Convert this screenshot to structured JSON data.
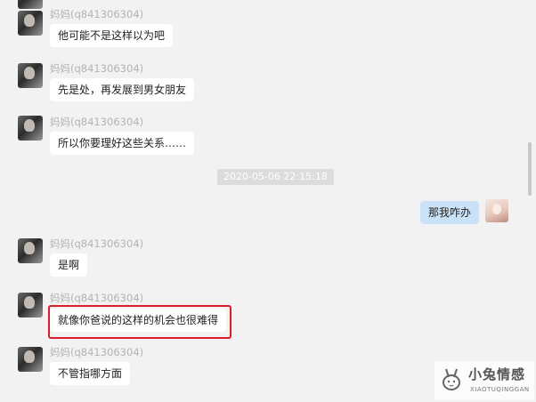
{
  "messages": [
    {
      "sender": "妈妈(q841306304)",
      "text": "他可能不是这样以为吧"
    },
    {
      "sender": "妈妈(q841306304)",
      "text": "先是处，再发展到男女朋友"
    },
    {
      "sender": "妈妈(q841306304)",
      "text": "所以你要理好这些关系……"
    },
    {
      "sender": "妈妈(q841306304)",
      "text": "是啊"
    },
    {
      "sender": "妈妈(q841306304)",
      "text": "就像你爸说的这样的机会也很难得"
    },
    {
      "sender": "妈妈(q841306304)",
      "text": "不管指哪方面"
    }
  ],
  "timestamp": "2020-05-06 22:15:18",
  "my_message": {
    "text": "那我咋办"
  },
  "watermark": {
    "title": "小兔情感",
    "subtitle": "XIAOTUQINGGAN"
  },
  "colors": {
    "highlight": "#d91e2a",
    "my_bubble": "#c9e2f7",
    "background": "#f2f2f2"
  }
}
